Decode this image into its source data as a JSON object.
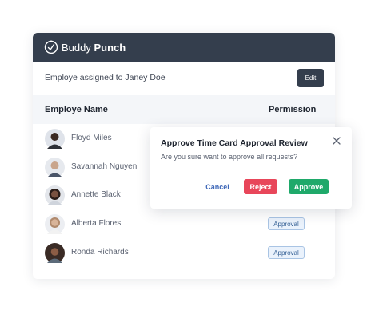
{
  "brand": {
    "name_regular": "Buddy",
    "name_bold": "Punch",
    "logo_icon": "clock-icon"
  },
  "assignment": {
    "text": "Employe assigned to Janey Doe",
    "edit_label": "Edit"
  },
  "table": {
    "columns": [
      "Employe Name",
      "Permission"
    ],
    "rows": [
      {
        "name": "Floyd Miles",
        "permission": ""
      },
      {
        "name": "Savannah Nguyen",
        "permission": ""
      },
      {
        "name": "Annette Black",
        "permission": ""
      },
      {
        "name": "Alberta Flores",
        "permission": "Approval"
      },
      {
        "name": "Ronda Richards",
        "permission": "Approval"
      }
    ]
  },
  "modal": {
    "title": "Approve Time Card Approval Review",
    "message": "Are you sure want to approve all requests?",
    "close_icon": "close-icon",
    "cancel_label": "Cancel",
    "reject_label": "Reject",
    "approve_label": "Approve"
  },
  "colors": {
    "header_bg": "#343e4d",
    "reject": "#e8465a",
    "approve": "#1fa96a",
    "link": "#3f68b8",
    "badge_bg": "#eaf2fc"
  }
}
